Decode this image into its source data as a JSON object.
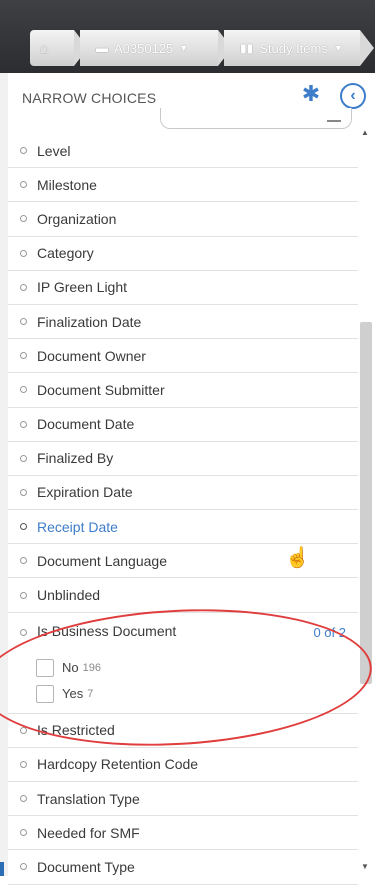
{
  "breadcrumbs": [
    {
      "label": "",
      "icon": "home-icon"
    },
    {
      "label": "A0350125",
      "icon": "folder-icon"
    },
    {
      "label": "Study Items",
      "icon": "books-icon"
    }
  ],
  "panel": {
    "title": "NARROW CHOICES",
    "gear_icon": "gear-icon",
    "collapse_icon": "chevron-left-icon"
  },
  "facets": [
    {
      "label": "Level"
    },
    {
      "label": "Milestone"
    },
    {
      "label": "Organization"
    },
    {
      "label": "Category"
    },
    {
      "label": "IP Green Light"
    },
    {
      "label": "Finalization Date"
    },
    {
      "label": "Document Owner"
    },
    {
      "label": "Document Submitter"
    },
    {
      "label": "Document Date"
    },
    {
      "label": "Finalized By"
    },
    {
      "label": "Expiration Date"
    },
    {
      "label": "Receipt Date",
      "active": true
    },
    {
      "label": "Document Language"
    },
    {
      "label": "Unblinded"
    },
    {
      "label": "Is Business Document",
      "count": "0 of 2",
      "options": [
        {
          "label": "No",
          "count": "196"
        },
        {
          "label": "Yes",
          "count": "7"
        }
      ]
    },
    {
      "label": "Is Restricted"
    },
    {
      "label": "Hardcopy Retention Code"
    },
    {
      "label": "Translation Type"
    },
    {
      "label": "Needed for SMF"
    },
    {
      "label": "Document Type"
    }
  ],
  "colors": {
    "accent": "#3d7dca",
    "annotation": "#e03d3d",
    "topbar": "#333437"
  }
}
